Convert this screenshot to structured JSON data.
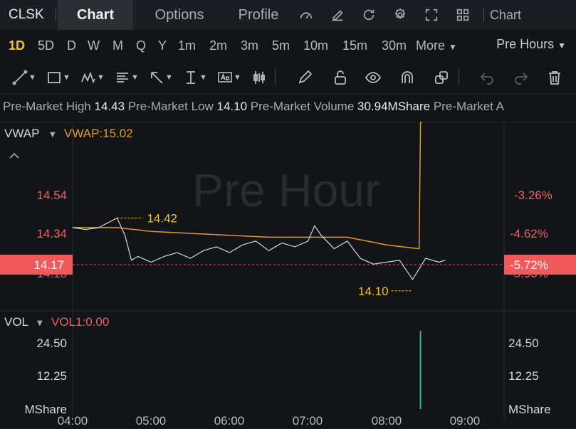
{
  "ticker": "CLSK",
  "tabs": [
    "Chart",
    "Options",
    "Profile"
  ],
  "chart_menu_label": "Chart",
  "periods": [
    "1D",
    "5D",
    "D",
    "W",
    "M",
    "Q",
    "Y",
    "1m",
    "2m",
    "3m",
    "5m",
    "10m",
    "15m",
    "30m",
    "More"
  ],
  "active_period": "1D",
  "session_selector": "Pre Hours",
  "info": {
    "high_label": "Pre-Market High",
    "high_value": "14.43",
    "low_label": "Pre-Market Low",
    "low_value": "14.10",
    "volume_label": "Pre-Market Volume",
    "volume_value": "30.94MShare",
    "trail_label": "Pre-Market A"
  },
  "indicator": {
    "name": "VWAP",
    "value_label": "VWAP:15.02"
  },
  "watermark": "Pre Hour",
  "price_axis": [
    "14.54",
    "14.34",
    "14.13"
  ],
  "current_price": "14.17",
  "pct_axis": [
    "-3.26%",
    "-4.62%",
    "-5.93%"
  ],
  "current_pct": "-5.72%",
  "high_marker": "14.42",
  "low_marker": "14.10",
  "volume_panel": {
    "name": "VOL",
    "value_label": "VOL1:0.00",
    "axis": [
      "24.50",
      "12.25",
      "MShare"
    ]
  },
  "time_axis": [
    "04:00",
    "05:00",
    "06:00",
    "07:00",
    "08:00",
    "09:00"
  ],
  "colors": {
    "price_line": "#d8d8d8",
    "vwap_line": "#e09a2b",
    "current_price_bg": "#f05a5a",
    "axis_red": "#f06060",
    "marker_yellow": "#f5c518",
    "volume_bar": "#26c281"
  },
  "chart_data": {
    "type": "line",
    "price": {
      "x": [
        "04:00",
        "04:10",
        "04:20",
        "04:34",
        "04:40",
        "04:45",
        "04:50",
        "05:00",
        "05:10",
        "05:20",
        "05:30",
        "05:40",
        "05:50",
        "06:00",
        "06:10",
        "06:20",
        "06:30",
        "06:40",
        "06:50",
        "07:00",
        "07:05",
        "07:10",
        "07:20",
        "07:30",
        "07:40",
        "07:50",
        "08:00",
        "08:10",
        "08:15",
        "08:20",
        "08:30",
        "08:40",
        "08:45"
      ],
      "y": [
        14.37,
        14.36,
        14.37,
        14.42,
        14.33,
        14.2,
        14.22,
        14.19,
        14.22,
        14.24,
        14.21,
        14.25,
        14.27,
        14.24,
        14.28,
        14.3,
        14.25,
        14.29,
        14.27,
        14.3,
        14.38,
        14.33,
        14.26,
        14.3,
        14.21,
        14.18,
        14.19,
        14.2,
        14.15,
        14.1,
        14.21,
        14.19,
        14.2
      ]
    },
    "vwap": {
      "x": [
        "04:00",
        "04:34",
        "05:00",
        "05:30",
        "06:00",
        "06:30",
        "07:00",
        "07:30",
        "08:00",
        "08:25",
        "08:26",
        "08:27"
      ],
      "y": [
        14.37,
        14.37,
        14.35,
        14.34,
        14.33,
        14.32,
        14.32,
        14.32,
        14.28,
        14.26,
        15.02,
        15.6
      ]
    },
    "volume": {
      "x": [
        "08:26"
      ],
      "y": [
        29.0
      ]
    },
    "ylim": [
      14.1,
      14.6
    ],
    "volume_ylim": [
      0,
      30
    ],
    "xlim": [
      "04:00",
      "09:00"
    ]
  }
}
